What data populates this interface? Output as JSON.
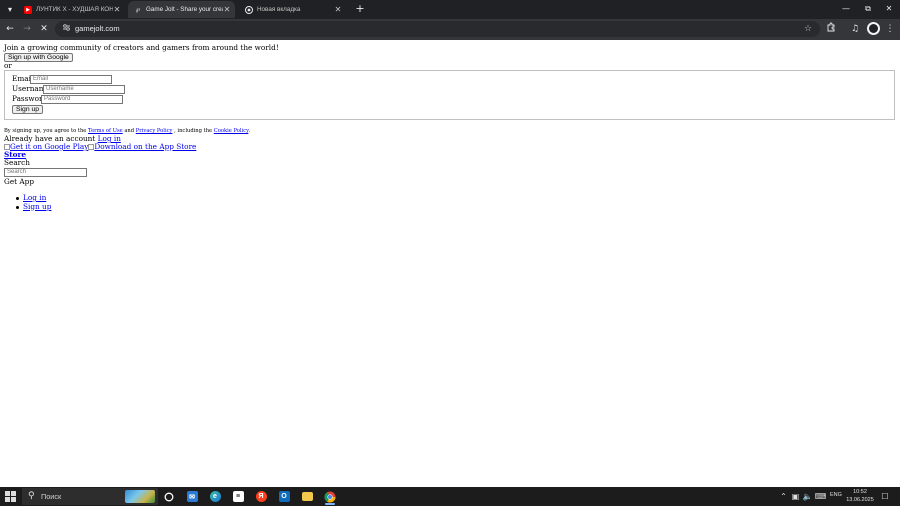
{
  "browser": {
    "tabs": [
      {
        "title": "ЛУНТИК X - ХУДШАЯ КОНЦОВКА",
        "favicon": "youtube-icon",
        "active": false
      },
      {
        "title": "Game Jolt - Share your creations",
        "favicon": "gamejolt-icon",
        "active": true
      },
      {
        "title": "Новая вкладка",
        "favicon": "chrome-icon",
        "active": false
      }
    ],
    "address_bar": {
      "url": "gamejolt.com"
    }
  },
  "page": {
    "intro": "Join a growing community of creators and gamers from around the world!",
    "google_signup_label": "Sign up with Google",
    "or_text": "or",
    "form": {
      "email_label": "Email",
      "email_placeholder": "Email",
      "username_label": "Username",
      "username_placeholder": "Username",
      "password_label": "Password",
      "password_placeholder": "Password",
      "signup_button": "Sign up"
    },
    "terms": {
      "prefix": "By signing up, you agree to the",
      "terms_link": "Terms of Use",
      "and_text": "and",
      "privacy_link": "Privacy Policy",
      "including_text": ", including the",
      "cookie_link": "Cookie Policy",
      "suffix": "."
    },
    "account": {
      "text": "Already have an account",
      "login_link": "Log in"
    },
    "app_links": {
      "google_play": "Get it on Google Play",
      "app_store": "Download on the App Store"
    },
    "store_link": "Store",
    "search_label": "Search",
    "search_placeholder": "Search",
    "get_app": "Get App",
    "nav": [
      {
        "label": "Log in"
      },
      {
        "label": "Sign up"
      }
    ]
  },
  "taskbar": {
    "search_text": "Поиск",
    "language": "ENG",
    "time": "10:52",
    "date": "13.06.2025"
  }
}
